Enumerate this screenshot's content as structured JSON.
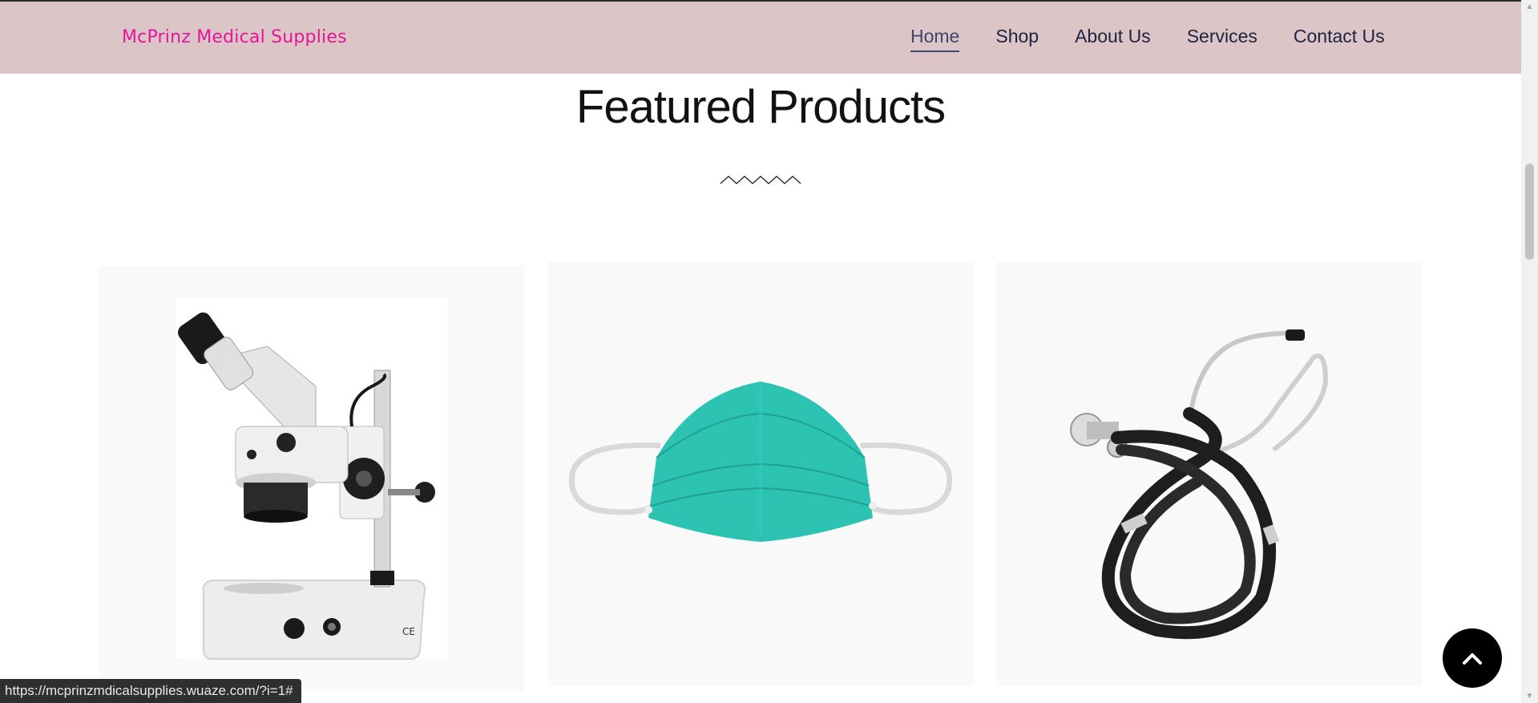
{
  "header": {
    "brand": "McPrinz Medical Supplies",
    "nav": [
      {
        "label": "Home",
        "active": true
      },
      {
        "label": "Shop",
        "active": false
      },
      {
        "label": "About Us",
        "active": false
      },
      {
        "label": "Services",
        "active": false
      },
      {
        "label": "Contact Us",
        "active": false
      }
    ]
  },
  "main": {
    "section_title": "Featured Products",
    "products": [
      {
        "image": "microscope"
      },
      {
        "image": "surgical-mask"
      },
      {
        "image": "stethoscope"
      }
    ]
  },
  "status_bar": {
    "url": "https://mcprinzmdicalsupplies.wuaze.com/?i=1#"
  },
  "colors": {
    "header_bg": "#dcc5c6",
    "brand": "#e5169a",
    "nav_text": "#1e2340",
    "mask": "#2cc3b3"
  },
  "icons": {
    "back_to_top": "chevron-up-icon",
    "divider": "zigzag-divider"
  }
}
